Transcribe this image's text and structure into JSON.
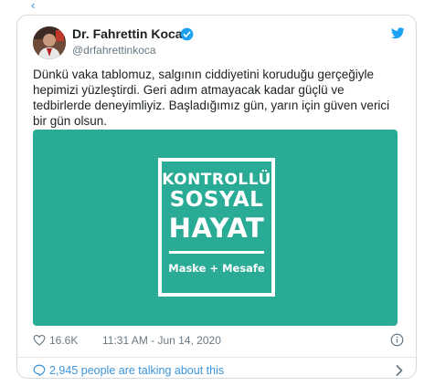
{
  "top_fragment": "‹",
  "author": {
    "name": "Dr. Fahrettin Koca",
    "handle": "@drfahrettinkoca",
    "verified": true
  },
  "tweet": {
    "text": "Dünkü vaka tablomuz, salgının ciddiyetini koruduğu gerçeğiyle hepimizi yüzleştirdi. Geri adım atmayacak kadar güçlü ve tedbirlerde deneyimliyiz. Başladığımız gün, yarın için güven verici bir gün olsun."
  },
  "media": {
    "background_color": "#2aab96",
    "logo_line1": "KONTROLLÜ",
    "logo_line2": "SOSYAL",
    "logo_line3": "HAYAT",
    "logo_tagline": "Maske + Mesafe"
  },
  "meta": {
    "like_count": "16.6K",
    "timestamp": "11:31 AM - Jun 14, 2020"
  },
  "conversation": {
    "text": "2,945 people are talking about this"
  },
  "colors": {
    "link": "#3b94d9",
    "muted": "#697882",
    "twitter_blue": "#1da1f2"
  },
  "icons": [
    "verified-badge-icon",
    "twitter-bird-icon",
    "heart-icon",
    "info-icon",
    "speech-bubble-icon",
    "chevron-right-icon"
  ]
}
